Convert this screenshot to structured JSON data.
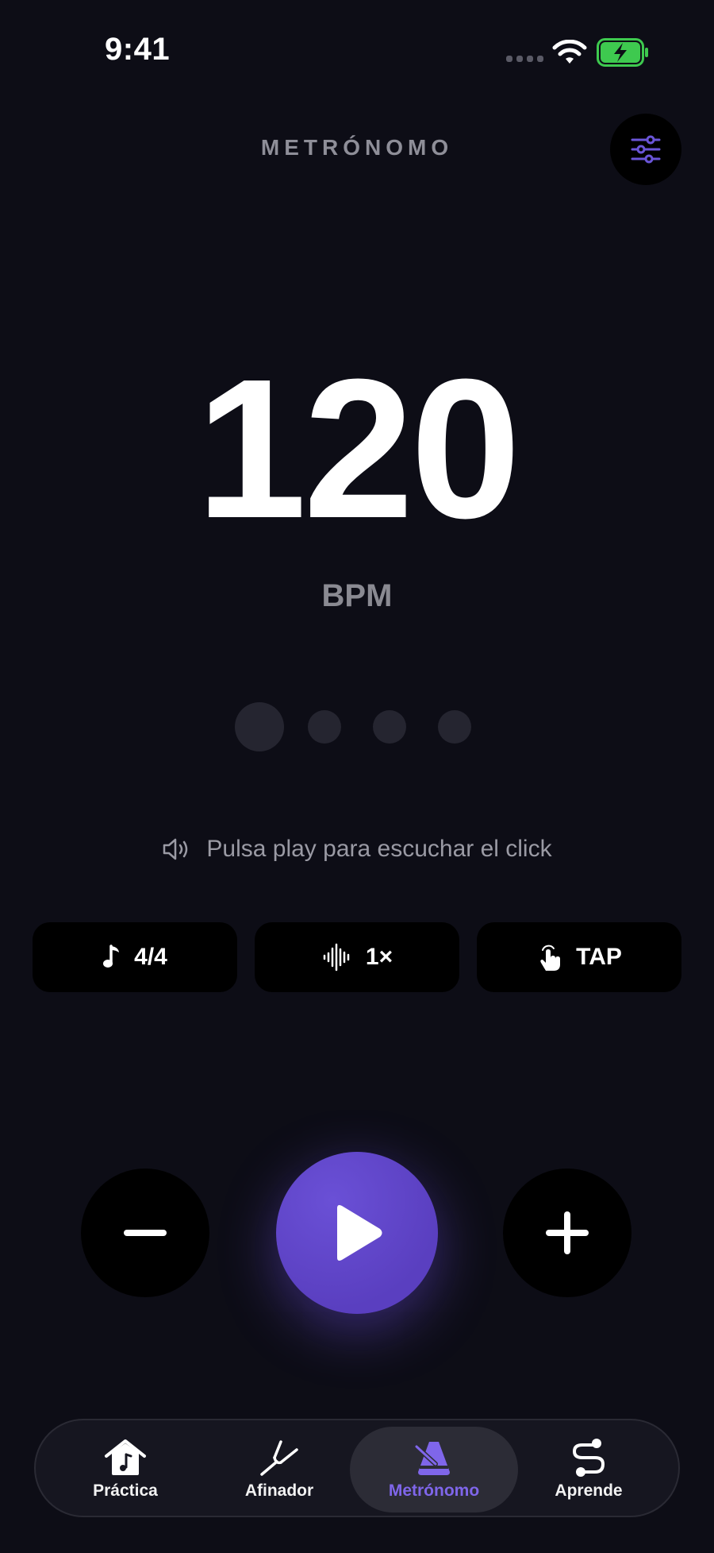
{
  "status_bar": {
    "time": "9:41"
  },
  "header": {
    "title": "METRÓNOMO"
  },
  "tempo": {
    "bpm": "120",
    "unit": "BPM"
  },
  "beats": {
    "count": 4,
    "current": 1
  },
  "hint": {
    "text": "Pulsa play para escuchar el click"
  },
  "options": {
    "time_signature": "4/4",
    "subdivision": "1×",
    "tap": "TAP"
  },
  "tabs": [
    {
      "label": "Práctica",
      "icon": "house-music-icon"
    },
    {
      "label": "Afinador",
      "icon": "tuning-fork-icon"
    },
    {
      "label": "Metrónomo",
      "icon": "metronome-icon",
      "active": true
    },
    {
      "label": "Aprende",
      "icon": "path-icon"
    }
  ],
  "colors": {
    "background": "#0d0d16",
    "accent": "#6a50d6",
    "battery_green": "#3ec94f"
  }
}
